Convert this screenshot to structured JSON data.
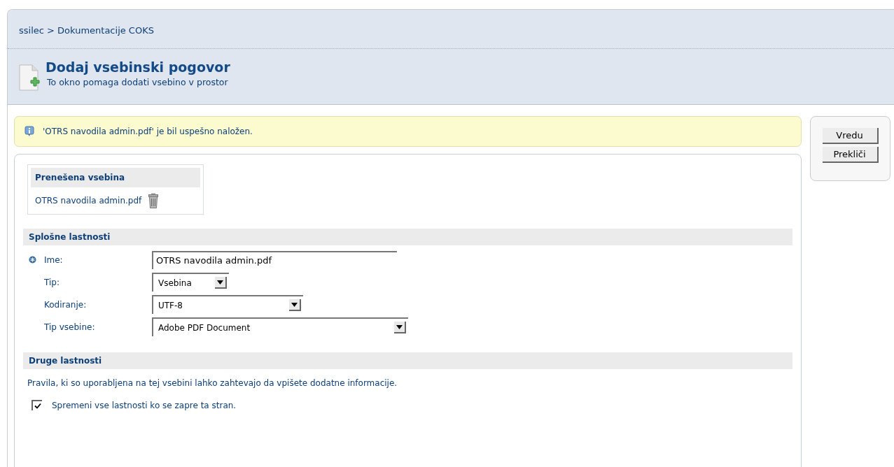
{
  "breadcrumb": "ssilec > Dokumentacije COKS",
  "title": "Dodaj vsebinski pogovor",
  "subtitle": "To okno pomaga dodati vsebino v prostor",
  "message": "'OTRS navodila admin.pdf' je bil uspešno naložen.",
  "uploaded": {
    "heading": "Prenešena vsebina",
    "file": "OTRS navodila admin.pdf"
  },
  "general": {
    "heading": "Splošne lastnosti",
    "fields": [
      {
        "kind": "text",
        "label": "Ime:",
        "value": "OTRS navodila admin.pdf",
        "required": true
      },
      {
        "kind": "select",
        "label": "Tip:",
        "value": "Vsebina",
        "required": false
      },
      {
        "kind": "select",
        "label": "Kodiranje:",
        "value": "UTF-8",
        "required": false
      },
      {
        "kind": "select",
        "label": "Tip vsebine:",
        "value": "Adobe PDF Document",
        "required": false
      }
    ]
  },
  "other": {
    "heading": "Druge lastnosti",
    "note": "Pravila, ki so uporabljena na tej vsebini lahko zahtevajo da vpišete dodatne informacije.",
    "checkbox": {
      "label": "Spremeni vse lastnosti ko se zapre ta stran.",
      "checked": true
    }
  },
  "buttons": [
    "Vredu",
    "Prekliči"
  ]
}
